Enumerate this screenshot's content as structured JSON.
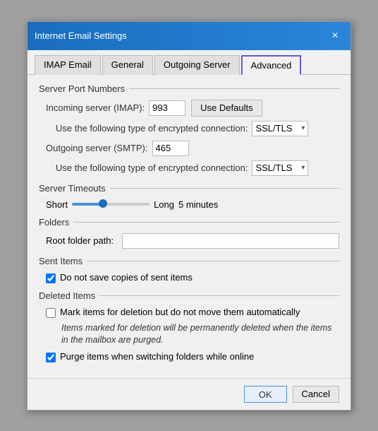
{
  "dialog": {
    "title": "Internet Email Settings",
    "close_label": "×"
  },
  "tabs": [
    {
      "id": "imap",
      "label": "IMAP Email",
      "active": false
    },
    {
      "id": "general",
      "label": "General",
      "active": false
    },
    {
      "id": "outgoing",
      "label": "Outgoing Server",
      "active": false
    },
    {
      "id": "advanced",
      "label": "Advanced",
      "active": true
    }
  ],
  "sections": {
    "server_ports": {
      "header": "Server Port Numbers",
      "incoming_label": "Incoming server (IMAP):",
      "incoming_value": "993",
      "use_defaults_label": "Use Defaults",
      "encrypted_label_1": "Use the following type of encrypted connection:",
      "encrypted_value_1": "SSL/TLS",
      "outgoing_label": "Outgoing server (SMTP):",
      "outgoing_value": "465",
      "encrypted_label_2": "Use the following type of encrypted connection:",
      "encrypted_value_2": "SSL/TLS"
    },
    "server_timeouts": {
      "header": "Server Timeouts",
      "short_label": "Short",
      "long_label": "Long",
      "duration": "5 minutes"
    },
    "folders": {
      "header": "Folders",
      "root_label": "Root folder path:",
      "root_value": ""
    },
    "sent_items": {
      "header": "Sent Items",
      "checkbox_label": "Do not save copies of sent items",
      "checked": true
    },
    "deleted_items": {
      "header": "Deleted Items",
      "mark_label": "Mark items for deletion but do not move them automatically",
      "mark_checked": false,
      "info_text": "Items marked for deletion will be permanently deleted when the items in the mailbox are purged.",
      "purge_label": "Purge items when switching folders while online",
      "purge_checked": true
    }
  },
  "footer": {
    "ok_label": "OK",
    "cancel_label": "Cancel"
  }
}
